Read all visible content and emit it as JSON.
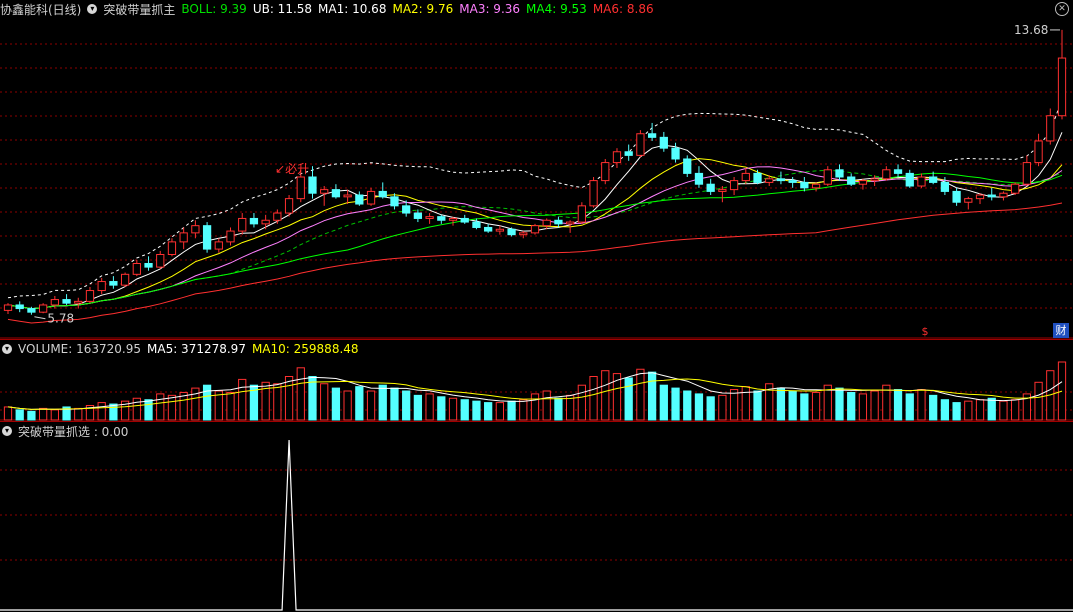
{
  "header": {
    "stock": "协鑫能科(日线)",
    "indicator": "突破带量抓主",
    "values": [
      {
        "label": "BOLL: 9.39",
        "color": "#00e000"
      },
      {
        "label": "UB: 11.58",
        "color": "#ffffff"
      },
      {
        "label": "MA1: 10.68",
        "color": "#ffffff"
      },
      {
        "label": "MA2: 9.76",
        "color": "#ffff00"
      },
      {
        "label": "MA3: 9.36",
        "color": "#ff80ff"
      },
      {
        "label": "MA4: 9.53",
        "color": "#00ff00"
      },
      {
        "label": "MA6: 8.86",
        "color": "#ff3030"
      }
    ]
  },
  "price_panel": {
    "high_label": "13.68",
    "low_label": "5.78",
    "signal_text": "必升",
    "dollar_marker": "$",
    "cai_badge": "财"
  },
  "volume_panel": {
    "title": "VOLUME: 163720.95",
    "ma5": "MA5: 371278.97",
    "ma10": "MA10: 259888.48"
  },
  "signal_panel": {
    "title": "突破带量抓选 : 0.00"
  },
  "colors": {
    "up": "#ff3030",
    "down": "#54ffff",
    "grid": "#8b0000"
  },
  "chart_data": {
    "type": "candlestick",
    "price_range": [
      5.3,
      13.9
    ],
    "candles": [
      [
        5.9,
        6.1,
        5.8,
        6.05
      ],
      [
        6.05,
        6.15,
        5.85,
        5.95
      ],
      [
        5.95,
        6.0,
        5.78,
        5.85
      ],
      [
        5.85,
        6.1,
        5.82,
        6.05
      ],
      [
        6.05,
        6.3,
        5.95,
        6.2
      ],
      [
        6.2,
        6.35,
        6.05,
        6.1
      ],
      [
        6.1,
        6.25,
        5.95,
        6.15
      ],
      [
        6.15,
        6.55,
        6.1,
        6.45
      ],
      [
        6.45,
        6.8,
        6.35,
        6.7
      ],
      [
        6.7,
        6.85,
        6.5,
        6.6
      ],
      [
        6.6,
        6.95,
        6.55,
        6.9
      ],
      [
        6.9,
        7.3,
        6.85,
        7.2
      ],
      [
        7.2,
        7.4,
        7.0,
        7.1
      ],
      [
        7.1,
        7.55,
        7.05,
        7.45
      ],
      [
        7.45,
        7.9,
        7.4,
        7.8
      ],
      [
        7.8,
        8.2,
        7.6,
        8.05
      ],
      [
        8.05,
        8.4,
        7.9,
        8.25
      ],
      [
        8.25,
        8.35,
        7.5,
        7.6
      ],
      [
        7.6,
        7.9,
        7.5,
        7.8
      ],
      [
        7.8,
        8.2,
        7.7,
        8.1
      ],
      [
        8.1,
        8.6,
        8.0,
        8.45
      ],
      [
        8.45,
        8.6,
        8.2,
        8.3
      ],
      [
        8.3,
        8.55,
        8.15,
        8.4
      ],
      [
        8.4,
        8.7,
        8.3,
        8.6
      ],
      [
        8.6,
        9.1,
        8.5,
        9.0
      ],
      [
        9.0,
        9.8,
        8.9,
        9.6
      ],
      [
        9.6,
        9.9,
        9.0,
        9.15
      ],
      [
        9.15,
        9.35,
        8.8,
        9.25
      ],
      [
        9.25,
        9.4,
        9.0,
        9.05
      ],
      [
        9.05,
        9.25,
        8.85,
        9.1
      ],
      [
        9.1,
        9.2,
        8.8,
        8.85
      ],
      [
        8.85,
        9.3,
        8.8,
        9.2
      ],
      [
        9.2,
        9.45,
        9.0,
        9.05
      ],
      [
        9.05,
        9.15,
        8.7,
        8.8
      ],
      [
        8.8,
        8.95,
        8.5,
        8.6
      ],
      [
        8.6,
        8.7,
        8.35,
        8.45
      ],
      [
        8.45,
        8.6,
        8.3,
        8.5
      ],
      [
        8.5,
        8.55,
        8.3,
        8.4
      ],
      [
        8.4,
        8.5,
        8.25,
        8.45
      ],
      [
        8.45,
        8.55,
        8.3,
        8.35
      ],
      [
        8.35,
        8.45,
        8.15,
        8.2
      ],
      [
        8.2,
        8.3,
        8.05,
        8.1
      ],
      [
        8.1,
        8.25,
        8.0,
        8.15
      ],
      [
        8.15,
        8.2,
        7.95,
        8.0
      ],
      [
        8.0,
        8.1,
        7.9,
        8.05
      ],
      [
        8.05,
        8.3,
        8.0,
        8.25
      ],
      [
        8.25,
        8.45,
        8.15,
        8.4
      ],
      [
        8.4,
        8.5,
        8.2,
        8.3
      ],
      [
        8.3,
        8.4,
        8.05,
        8.35
      ],
      [
        8.35,
        8.9,
        8.3,
        8.8
      ],
      [
        8.8,
        9.6,
        8.75,
        9.5
      ],
      [
        9.5,
        10.1,
        9.4,
        10.0
      ],
      [
        10.0,
        10.4,
        9.85,
        10.3
      ],
      [
        10.3,
        10.5,
        10.05,
        10.2
      ],
      [
        10.2,
        10.9,
        10.15,
        10.8
      ],
      [
        10.8,
        11.1,
        10.6,
        10.7
      ],
      [
        10.7,
        10.85,
        10.3,
        10.4
      ],
      [
        10.4,
        10.55,
        10.0,
        10.1
      ],
      [
        10.1,
        10.2,
        9.6,
        9.7
      ],
      [
        9.7,
        9.9,
        9.3,
        9.4
      ],
      [
        9.4,
        9.55,
        9.1,
        9.2
      ],
      [
        9.2,
        9.35,
        8.9,
        9.25
      ],
      [
        9.25,
        9.6,
        9.1,
        9.5
      ],
      [
        9.5,
        9.85,
        9.4,
        9.7
      ],
      [
        9.7,
        9.8,
        9.4,
        9.45
      ],
      [
        9.45,
        9.65,
        9.35,
        9.55
      ],
      [
        9.55,
        9.75,
        9.4,
        9.5
      ],
      [
        9.5,
        9.6,
        9.3,
        9.45
      ],
      [
        9.45,
        9.6,
        9.2,
        9.3
      ],
      [
        9.3,
        9.45,
        9.2,
        9.4
      ],
      [
        9.4,
        9.9,
        9.35,
        9.8
      ],
      [
        9.8,
        9.95,
        9.5,
        9.6
      ],
      [
        9.6,
        9.7,
        9.35,
        9.4
      ],
      [
        9.4,
        9.55,
        9.25,
        9.5
      ],
      [
        9.5,
        9.65,
        9.35,
        9.55
      ],
      [
        9.55,
        9.9,
        9.5,
        9.8
      ],
      [
        9.8,
        9.95,
        9.6,
        9.7
      ],
      [
        9.7,
        9.8,
        9.3,
        9.35
      ],
      [
        9.35,
        9.7,
        9.3,
        9.6
      ],
      [
        9.6,
        9.75,
        9.4,
        9.45
      ],
      [
        9.45,
        9.6,
        9.1,
        9.2
      ],
      [
        9.2,
        9.3,
        8.8,
        8.9
      ],
      [
        8.9,
        9.05,
        8.7,
        9.0
      ],
      [
        9.0,
        9.15,
        8.85,
        9.1
      ],
      [
        9.1,
        9.3,
        8.95,
        9.05
      ],
      [
        9.05,
        9.2,
        8.95,
        9.15
      ],
      [
        9.15,
        9.45,
        9.1,
        9.4
      ],
      [
        9.4,
        10.2,
        9.35,
        10.0
      ],
      [
        10.0,
        10.8,
        9.9,
        10.6
      ],
      [
        10.6,
        11.5,
        10.5,
        11.3
      ],
      [
        11.3,
        13.68,
        11.2,
        12.9
      ]
    ],
    "volumes": [
      9,
      7,
      6,
      8,
      7,
      9,
      8,
      10,
      12,
      11,
      13,
      15,
      14,
      18,
      17,
      19,
      22,
      24,
      20,
      19,
      28,
      24,
      26,
      25,
      30,
      36,
      30,
      25,
      22,
      20,
      23,
      20,
      24,
      22,
      20,
      17,
      18,
      16,
      15,
      14,
      13,
      12,
      12,
      13,
      14,
      18,
      20,
      15,
      17,
      24,
      30,
      34,
      32,
      29,
      35,
      33,
      24,
      22,
      20,
      18,
      16,
      17,
      21,
      23,
      20,
      25,
      22,
      20,
      18,
      19,
      24,
      22,
      19,
      18,
      20,
      24,
      21,
      18,
      21,
      17,
      14,
      12,
      13,
      14,
      15,
      13,
      14,
      18,
      26,
      34,
      40
    ],
    "signal": {
      "peak_index": 24
    }
  }
}
